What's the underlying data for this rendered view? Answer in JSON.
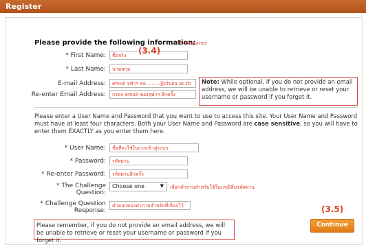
{
  "header": {
    "title": "Register"
  },
  "form": {
    "instructions": "Please provide the following information:",
    "required_note": "(*) Required",
    "first_name": {
      "label": "* First Name:",
      "value": "ชื่อจริง"
    },
    "last_name": {
      "label": "* Last Name:",
      "value": "นามสกุล"
    },
    "email": {
      "label": "E-mail Address:",
      "value": "email จุฬาฯ ex. .......@chula.ac.th"
    },
    "reemail": {
      "label": "Re-enter Email Address:",
      "value": "กรอก email ของจุฬาฯ อีกครั้ง"
    },
    "note_bold": "Note:",
    "note_text": " While optional, if you do not provide an email address, we will be unable to retrieve or reset your username or password if you forget it.",
    "username_instructions": "Please enter a User Name and Password that you want to use to access this site. Your User Name and Password must have at least four characters. Both your User Name and Password are ",
    "case_sensitive": "case sensitive",
    "username_instructions_end": ", so you will have to enter them EXACTLY as you enter them here.",
    "username": {
      "label": "* User Name:",
      "value": "ชื่อที่จะใช้ในการเข้าสู่ระบบ"
    },
    "password": {
      "label": "* Password:",
      "value": "รหัสผ่าน"
    },
    "repassword": {
      "label": "* Re-enter Password:",
      "value": "รหัสผ่านอีกครั้ง"
    },
    "challenge_q": {
      "label_line1": "* The Challenge",
      "label_line2": "Question:",
      "selected": "Choose one",
      "hint": "เลือกคำถามสำหรับใช้ในกรณีลืมรหัสผ่าน"
    },
    "challenge_r": {
      "label_line1": "* Challenge Question",
      "label_line2": "Response:",
      "value": "คำตอบของคำถามสำหรับที่เลือกไว้"
    },
    "reminder": "Please remember, if you do not provide an email address, we will be unable to retrieve or reset your username or password if you forget it.",
    "continue_label": "Continue"
  },
  "annotations": {
    "a34": "(3.4)",
    "a35": "(3.5)"
  },
  "colors": {
    "header": "#b8591f",
    "annotation": "#d9441f",
    "button": "#e88a25",
    "required": "#d23c3c"
  }
}
